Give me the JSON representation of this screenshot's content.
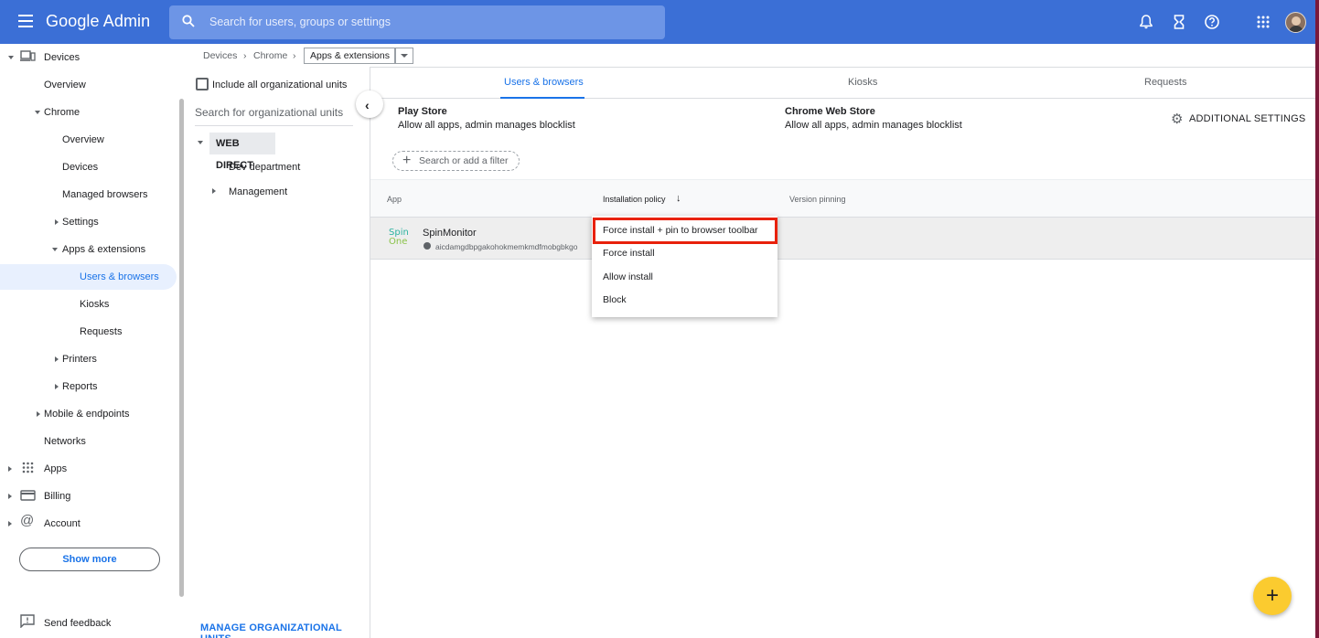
{
  "topbar": {
    "logo": "Google Admin",
    "search_placeholder": "Search for users, groups or settings",
    "icons": [
      "bell-icon",
      "hourglass-icon",
      "help-icon",
      "apps-grid-icon"
    ]
  },
  "breadcrumb": {
    "items": [
      "Devices",
      "Chrome"
    ],
    "current": "Apps & extensions"
  },
  "leftnav": {
    "devices": "Devices",
    "overview": "Overview",
    "chrome": "Chrome",
    "chrome_overview": "Overview",
    "chrome_devices": "Devices",
    "managed_browsers": "Managed browsers",
    "settings": "Settings",
    "apps_extensions": "Apps & extensions",
    "users_browsers": "Users & browsers",
    "kiosks": "Kiosks",
    "requests": "Requests",
    "printers": "Printers",
    "reports": "Reports",
    "mobile_endpoints": "Mobile & endpoints",
    "networks": "Networks",
    "apps": "Apps",
    "billing": "Billing",
    "account": "Account",
    "show_more": "Show more",
    "send_feedback": "Send feedback"
  },
  "orgpanel": {
    "include_label": "Include all organizational units",
    "search_placeholder": "Search for organizational units",
    "root": "WEB DIRECT",
    "children": [
      "Dev department",
      "Management"
    ],
    "manage_link": "MANAGE ORGANIZATIONAL UNITS"
  },
  "main": {
    "tabs": [
      "Users & browsers",
      "Kiosks",
      "Requests"
    ],
    "active_tab": "Users & browsers",
    "play_store": {
      "title": "Play Store",
      "desc": "Allow all apps, admin manages blocklist"
    },
    "web_store": {
      "title": "Chrome Web Store",
      "desc": "Allow all apps, admin manages blocklist"
    },
    "additional_settings": "ADDITIONAL SETTINGS",
    "filter_label": "Search or add a filter",
    "columns": [
      "App",
      "Installation policy",
      "Version pinning"
    ],
    "app": {
      "logo_line1": "Spin",
      "logo_line2": "One",
      "name": "SpinMonitor",
      "id": "aicdamgdbpgakohokmemkmdfmobgbkgo"
    }
  },
  "menu": {
    "items": [
      "Force install + pin to browser toolbar",
      "Force install",
      "Allow install",
      "Block"
    ],
    "highlighted": "Force install + pin to browser toolbar"
  },
  "fab": {
    "label": "+"
  },
  "colors": {
    "topbar": "#3b6fd6",
    "accent": "#1a73e8",
    "highlight_border": "#e8210b",
    "fab": "#fbcb2f"
  }
}
